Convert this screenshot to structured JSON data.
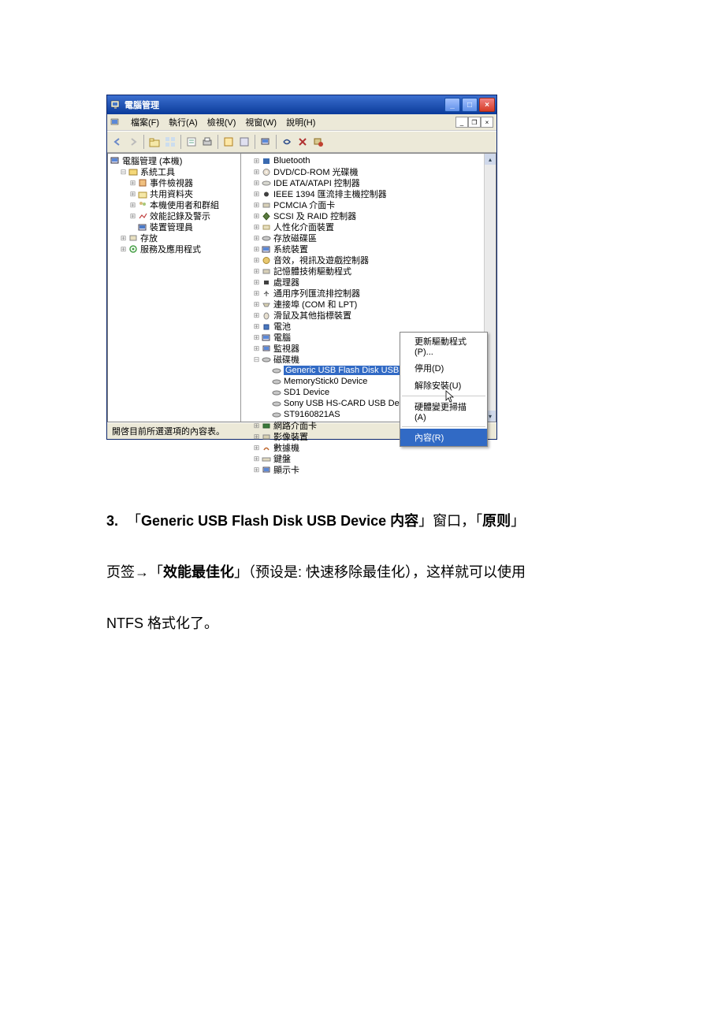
{
  "window": {
    "title": "電腦管理",
    "menu": {
      "file": "檔案(F)",
      "action": "執行(A)",
      "view": "檢視(V)",
      "window": "視窗(W)",
      "help": "說明(H)"
    },
    "statusbar": "開啓目前所選選項的內容表。"
  },
  "left_tree": {
    "root": "電腦管理 (本機)",
    "tools": "系統工具",
    "event": "事件檢視器",
    "shared": "共用資料夾",
    "users": "本機使用者和群組",
    "perf": "效能記錄及警示",
    "devmgr": "裝置管理員",
    "storage": "存放",
    "services": "服務及應用程式"
  },
  "right_tree": {
    "bt": "Bluetooth",
    "dvd": "DVD/CD-ROM 光碟機",
    "ide": "IDE ATA/ATAPI 控制器",
    "ieee": "IEEE 1394 匯流排主機控制器",
    "pcmcia": "PCMCIA 介面卡",
    "scsi": "SCSI 及 RAID 控制器",
    "hid": "人性化介面裝置",
    "volume": "存放磁碟區",
    "sysdev": "系統裝置",
    "avgame": "音效，視訊及遊戲控制器",
    "memdrv": "記憶體技術驅動程式",
    "cpu": "處理器",
    "usb": "通用序列匯流排控制器",
    "ports": "連接埠 (COM 和 LPT)",
    "mouse": "滑鼠及其他指標裝置",
    "battery": "電池",
    "computer": "電腦",
    "monitor": "監視器",
    "disk": "磁碟機",
    "disk1": "Generic USB Flash Disk USB Device",
    "disk2": "MemoryStick0 Device",
    "disk3": "SD1 Device",
    "disk4": "Sony USB   HS-CARD USB Device",
    "disk5": "ST9160821AS",
    "net": "網路介面卡",
    "img": "影像裝置",
    "modem": "數據機",
    "kbd": "鍵盤",
    "display": "顯示卡"
  },
  "context_menu": {
    "update": "更新驅動程式(P)...",
    "disable": "停用(D)",
    "uninstall": "解除安裝(U)",
    "scan": "硬體變更掃描(A)",
    "properties": "內容(R)"
  },
  "doc": {
    "num": "3.",
    "t1": "「",
    "t2": "Generic USB Flash Disk USB Device 内容",
    "t3": "」窗口，「",
    "t4": "原则",
    "t5": "」",
    "t6": "页签→「",
    "t7": "效能最佳化",
    "t8": "」（预设是: 快速移除最佳化），这样就可以使用",
    "t9": "NTFS 格式化了。"
  }
}
